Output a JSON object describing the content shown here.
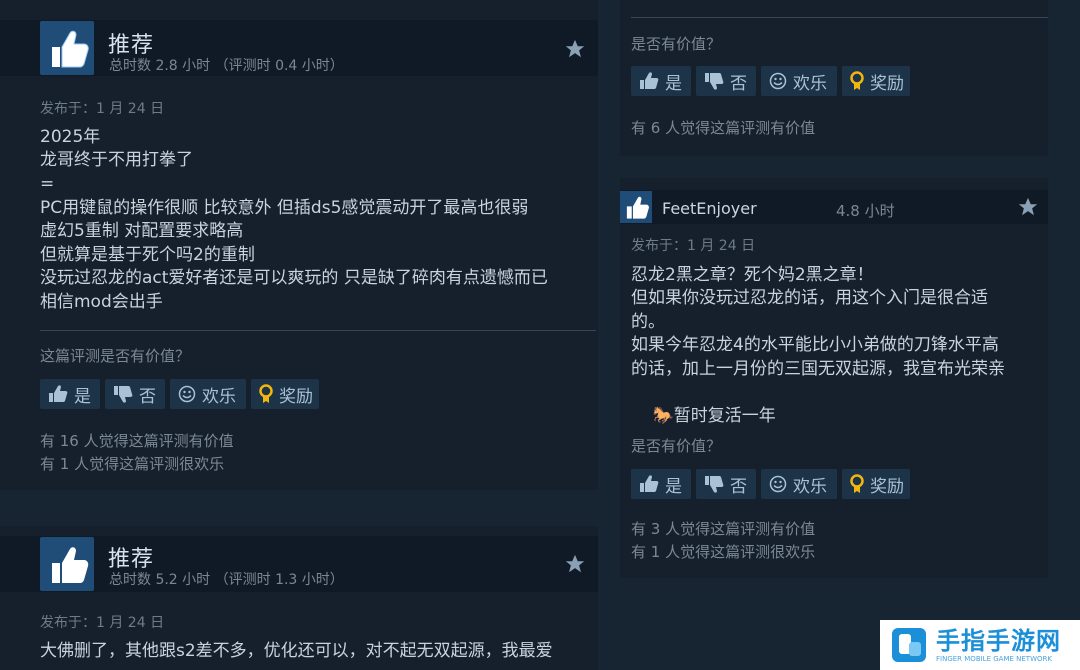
{
  "ui": {
    "recommended": "推荐",
    "posted_label": "发布于：1 月 24 日",
    "helpful_question": "这篇评测是否有价值？",
    "helpful_question_short": "是否有价值？",
    "btn_yes": "是",
    "btn_no": "否",
    "btn_funny": "欢乐",
    "btn_award": "奖励"
  },
  "review1": {
    "hours": "总时数 2.8 小时  （评测时 0.4 小时）",
    "posted": "发布于：1 月 24 日",
    "lines": [
      "2025年",
      "龙哥终于不用打拳了",
      "=",
      "PC用键鼠的操作很顺 比较意外 但插ds5感觉震动开了最高也很弱",
      "虚幻5重制 对配置要求略高",
      "但就算是基于死个吗2的重制",
      "没玩过忍龙的act爱好者还是可以爽玩的 只是缺了碎肉有点遗憾而已",
      "相信mod会出手"
    ],
    "helpful_count": "有 16 人觉得这篇评测有价值",
    "funny_count": "有 1 人觉得这篇评测很欢乐"
  },
  "review2": {
    "hours": "总时数 5.2 小时  （评测时 1.3 小时）",
    "posted": "发布于：1 月 24 日",
    "lines": [
      "大佛删了，其他跟s2差不多，优化还可以，对不起无双起源，我最爱"
    ]
  },
  "review_top_right": {
    "helpful_count": "有 6 人觉得这篇评测有价值"
  },
  "review3": {
    "username": "FeetEnjoyer",
    "hours": "4.8 小时",
    "posted": "发布于：1 月 24 日",
    "lines": [
      "忍龙2黑之章？死个妈2黑之章！",
      "但如果你没玩过忍龙的话，用这个入门是很合适",
      "的。",
      "如果今年忍龙4的水平能比小小弟做的刀锋水平高",
      "的话，加上一月份的三国无双起源，我宣布光荣亲"
    ],
    "last_line_emoji": "🐎",
    "last_line": "暂时复活一年",
    "helpful_count": "有 3 人觉得这篇评测有价值",
    "funny_count": "有 1 人觉得这篇评测很欢乐"
  },
  "watermark": {
    "title": "手指手游网",
    "subtitle": "FINGER MOBILE GAME NETWORK"
  },
  "colors": {
    "page_bg": "#172432",
    "card_bg": "#16202d",
    "header_bg": "#0f1a26",
    "button_bg": "#1d3347",
    "button_text": "#a9c2d6",
    "award_gold": "#f2b60f",
    "logo_blue": "#1b8fd8"
  },
  "icons": [
    "thumbs-up-icon",
    "thumbs-down-icon",
    "smiley-icon",
    "award-ribbon-icon",
    "star-icon"
  ]
}
